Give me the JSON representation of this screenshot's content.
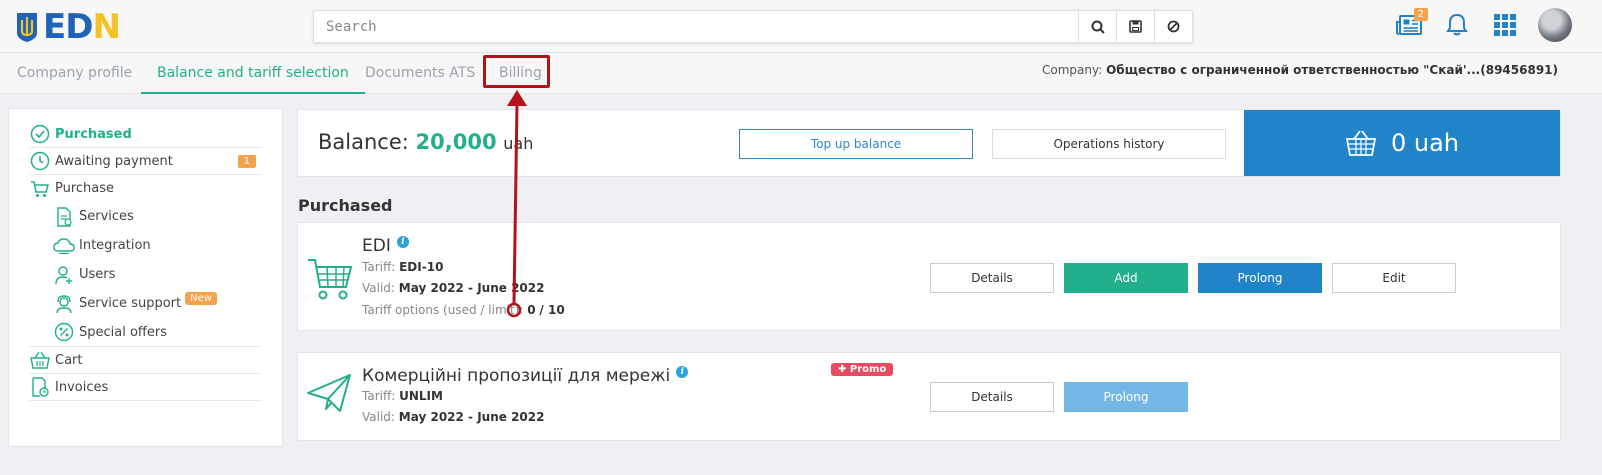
{
  "header": {
    "logo": {
      "text_blue": "ED",
      "text_yellow": "N"
    },
    "search": {
      "placeholder": "Search"
    },
    "search_buttons": [
      "search-icon",
      "save-icon",
      "cancel-icon"
    ],
    "icons": {
      "news_badge": "2"
    }
  },
  "tabs": [
    {
      "label": "Company profile",
      "active": false
    },
    {
      "label": "Balance and tariff selection",
      "active": true
    },
    {
      "label": "Documents ATS",
      "active": false
    },
    {
      "label": "Billing",
      "active": false
    }
  ],
  "company": {
    "label": "Company:",
    "value": "Общество с ограниченной ответственностью \"Скай'...(89456891)"
  },
  "sidebar": {
    "items": [
      {
        "label": "Purchased",
        "icon": "check-circle-icon",
        "active": true
      },
      {
        "label": "Awaiting payment",
        "icon": "clock-icon",
        "badge": "1"
      },
      {
        "label": "Purchase",
        "icon": "cart-icon"
      },
      {
        "label": "Services",
        "icon": "document-icon"
      },
      {
        "label": "Integration",
        "icon": "cloud-icon"
      },
      {
        "label": "Users",
        "icon": "user-add-icon"
      },
      {
        "label": "Service support",
        "icon": "headset-icon",
        "badge": "New"
      },
      {
        "label": "Special offers",
        "icon": "percent-icon"
      },
      {
        "label": "Cart",
        "icon": "basket-icon"
      },
      {
        "label": "Invoices",
        "icon": "invoice-icon"
      }
    ]
  },
  "balance": {
    "label": "Balance:",
    "amount": "20,000",
    "unit": "uah",
    "topup_label": "Top up balance",
    "history_label": "Operations history",
    "cart_total": "0 uah"
  },
  "section_title": "Purchased",
  "products": [
    {
      "name": "EDI",
      "tariff_label": "Tariff:",
      "tariff": "EDI-10",
      "valid_label": "Valid:",
      "valid": "May 2022 - June 2022",
      "options_label": "Tariff options (used / limit):",
      "options_used": "0",
      "options_limit": "/ 10",
      "buttons": {
        "details": "Details",
        "add": "Add",
        "prolong": "Prolong",
        "edit": "Edit"
      }
    },
    {
      "name": "Комерційні пропозиції для мережі",
      "promo": "Promo",
      "tariff_label": "Tariff:",
      "tariff": "UNLIM",
      "valid_label": "Valid:",
      "valid": "May 2022 - June 2022",
      "buttons": {
        "details": "Details",
        "prolong": "Prolong"
      }
    }
  ],
  "colors": {
    "accent_green": "#22b08c",
    "primary_blue": "#2184c8",
    "badge_orange": "#f5a24b",
    "promo_red": "#e84b5f",
    "annotation_red": "#b2141a"
  }
}
